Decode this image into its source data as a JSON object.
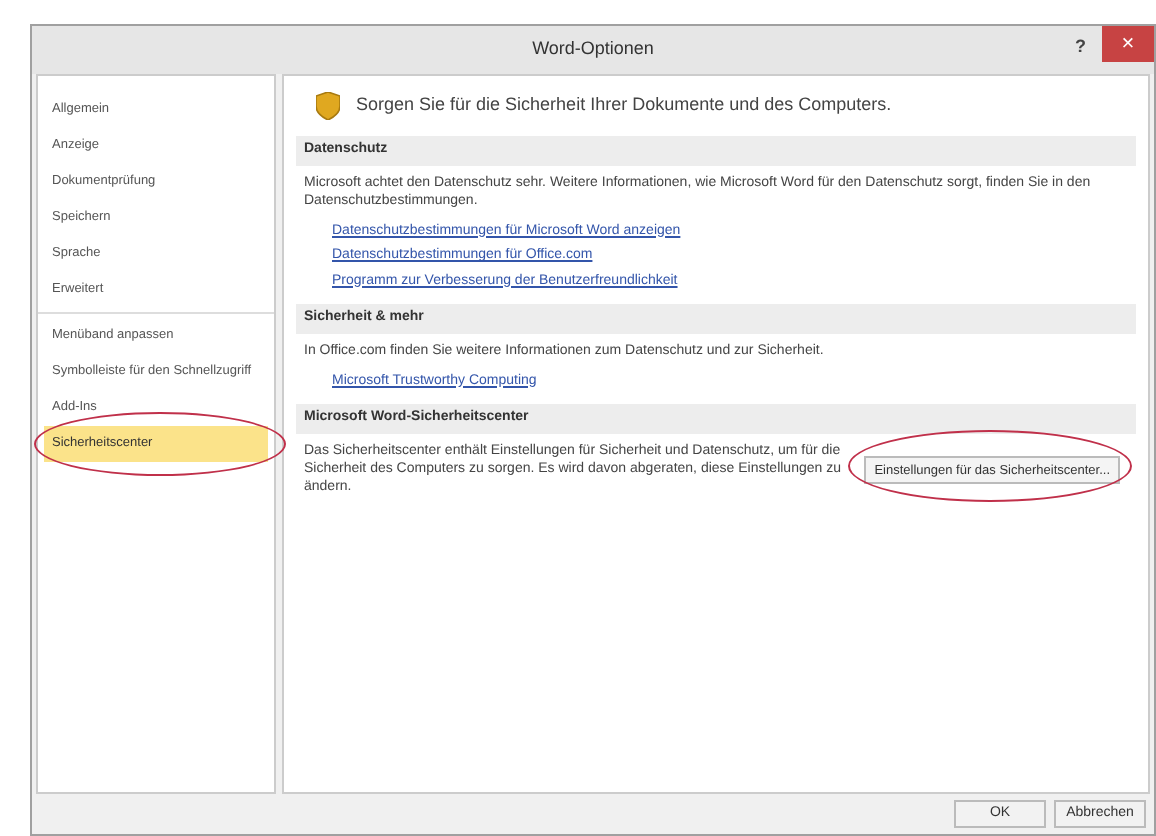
{
  "window": {
    "title": "Word-Optionen",
    "help": "?",
    "close": "×"
  },
  "sidebar": {
    "items": [
      {
        "label": "Allgemein",
        "selected": false,
        "circled": false
      },
      {
        "label": "Anzeige",
        "selected": false,
        "circled": false
      },
      {
        "label": "Dokumentprüfung",
        "selected": false,
        "circled": false
      },
      {
        "label": "Speichern",
        "selected": false,
        "circled": false
      },
      {
        "label": "Sprache",
        "selected": false,
        "circled": false
      },
      {
        "label": "Erweitert",
        "selected": false,
        "circled": false
      },
      {
        "label": "Menüband anpassen",
        "selected": false,
        "circled": false
      },
      {
        "label": "Symbolleiste für den Schnellzugriff",
        "selected": false,
        "circled": false
      },
      {
        "label": "Add-Ins",
        "selected": false,
        "circled": false
      },
      {
        "label": "Sicherheitscenter",
        "selected": true,
        "circled": true
      }
    ]
  },
  "header": "Sorgen Sie für die Sicherheit Ihrer Dokumente und des Computers.",
  "sections": [
    {
      "title": "Datenschutz",
      "text": "Microsoft achtet den Datenschutz sehr. Weitere Informationen, wie Microsoft Word für den Datenschutz sorgt, finden Sie in den Datenschutzbestimmungen.",
      "links": [
        "Datenschutzbestimmungen für Microsoft Word anzeigen",
        "Datenschutzbestimmungen für Office.com",
        "Programm zur Verbesserung der Benutzerfreundlichkeit"
      ]
    },
    {
      "title": "Sicherheit & mehr",
      "text": "In Office.com finden Sie weitere Informationen zum Datenschutz und zur Sicherheit.",
      "links": [
        "Microsoft Trustworthy Computing"
      ]
    },
    {
      "title": "Microsoft Word-Sicherheitscenter",
      "text": "Das Sicherheitscenter enthält Einstellungen für Sicherheit und Datenschutz, um für die Sicherheit des Computers zu sorgen. Es wird davon abgeraten, diese Einstellungen zu ändern.",
      "button": {
        "label": "Einstellungen für das Sicherheitscenter...",
        "circled": true
      }
    }
  ],
  "buttons": [
    "OK",
    "Abbrechen"
  ]
}
